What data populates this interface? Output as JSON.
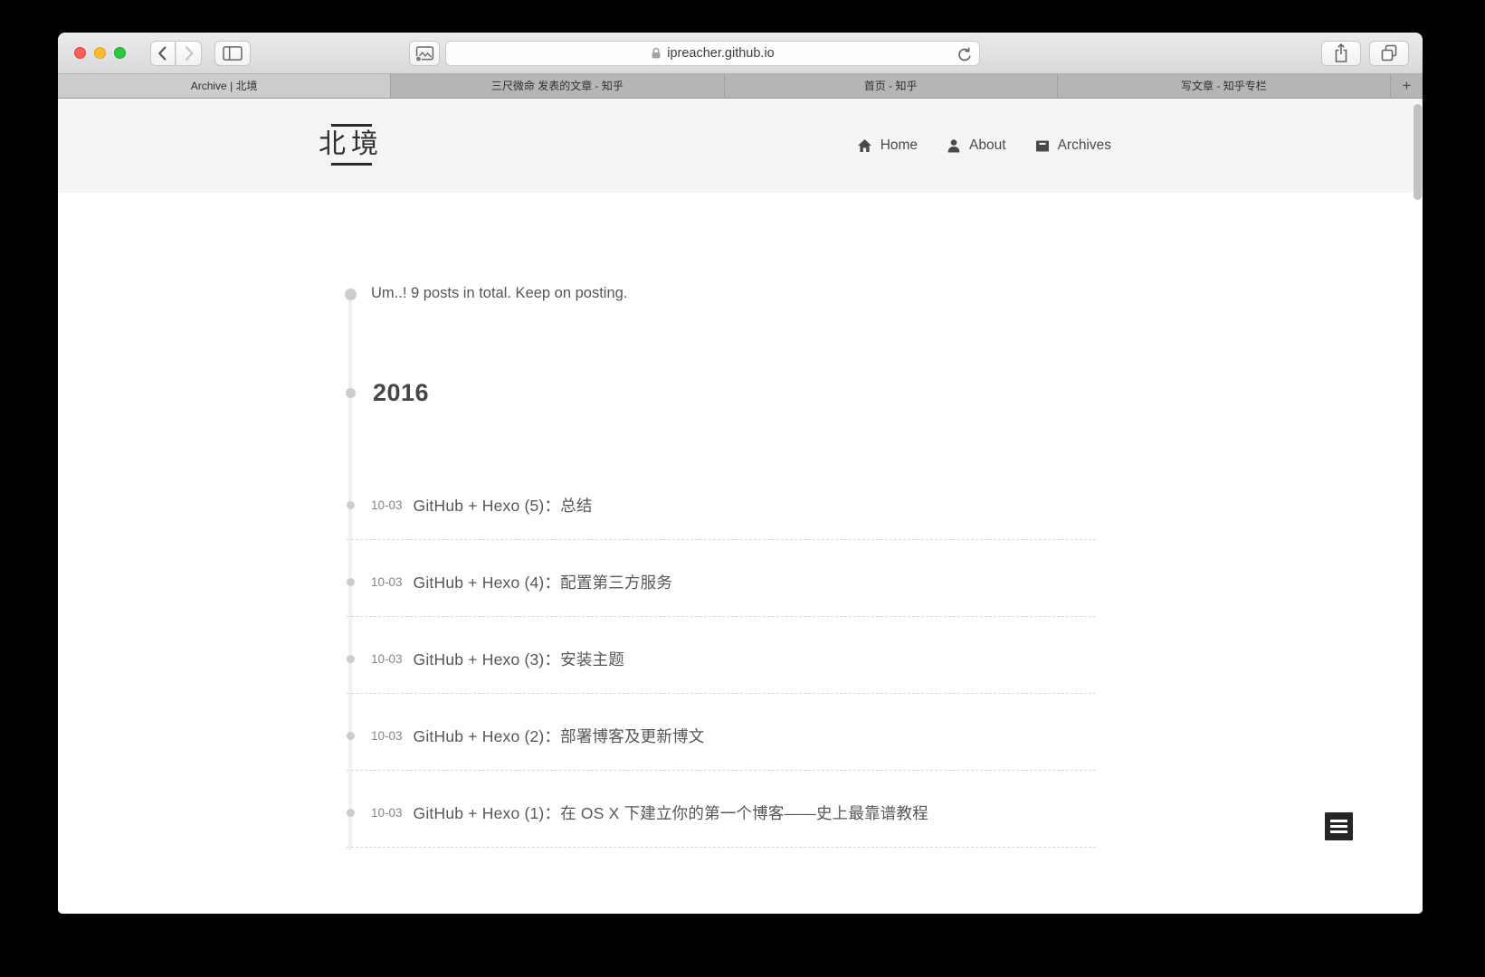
{
  "browser": {
    "url": "ipreacher.github.io",
    "new_tab_label": "+",
    "tabs": [
      {
        "label": "Archive | 北境",
        "active": true
      },
      {
        "label": "三尺微命 发表的文章 - 知乎",
        "active": false
      },
      {
        "label": "首页 - 知乎",
        "active": false
      },
      {
        "label": "写文章 - 知乎专栏",
        "active": false
      }
    ]
  },
  "site": {
    "logo": "北境",
    "nav": [
      {
        "label": "Home",
        "icon": "home-icon"
      },
      {
        "label": "About",
        "icon": "user-icon"
      },
      {
        "label": "Archives",
        "icon": "archive-icon"
      }
    ]
  },
  "archive": {
    "summary": "Um..! 9 posts in total. Keep on posting.",
    "year": "2016",
    "posts": [
      {
        "date": "10-03",
        "title": "GitHub + Hexo (5)：总结"
      },
      {
        "date": "10-03",
        "title": "GitHub + Hexo (4)：配置第三方服务"
      },
      {
        "date": "10-03",
        "title": "GitHub + Hexo (3)：安装主题"
      },
      {
        "date": "10-03",
        "title": "GitHub + Hexo (2)：部署博客及更新博文"
      },
      {
        "date": "10-03",
        "title": "GitHub + Hexo (1)：在 OS X 下建立你的第一个博客——史上最靠谱教程"
      }
    ]
  },
  "colors": {
    "accent_dark": "#262626",
    "header_bg": "#f5f5f5",
    "timeline": "#f1f1f1",
    "dot": "#cccccc"
  }
}
